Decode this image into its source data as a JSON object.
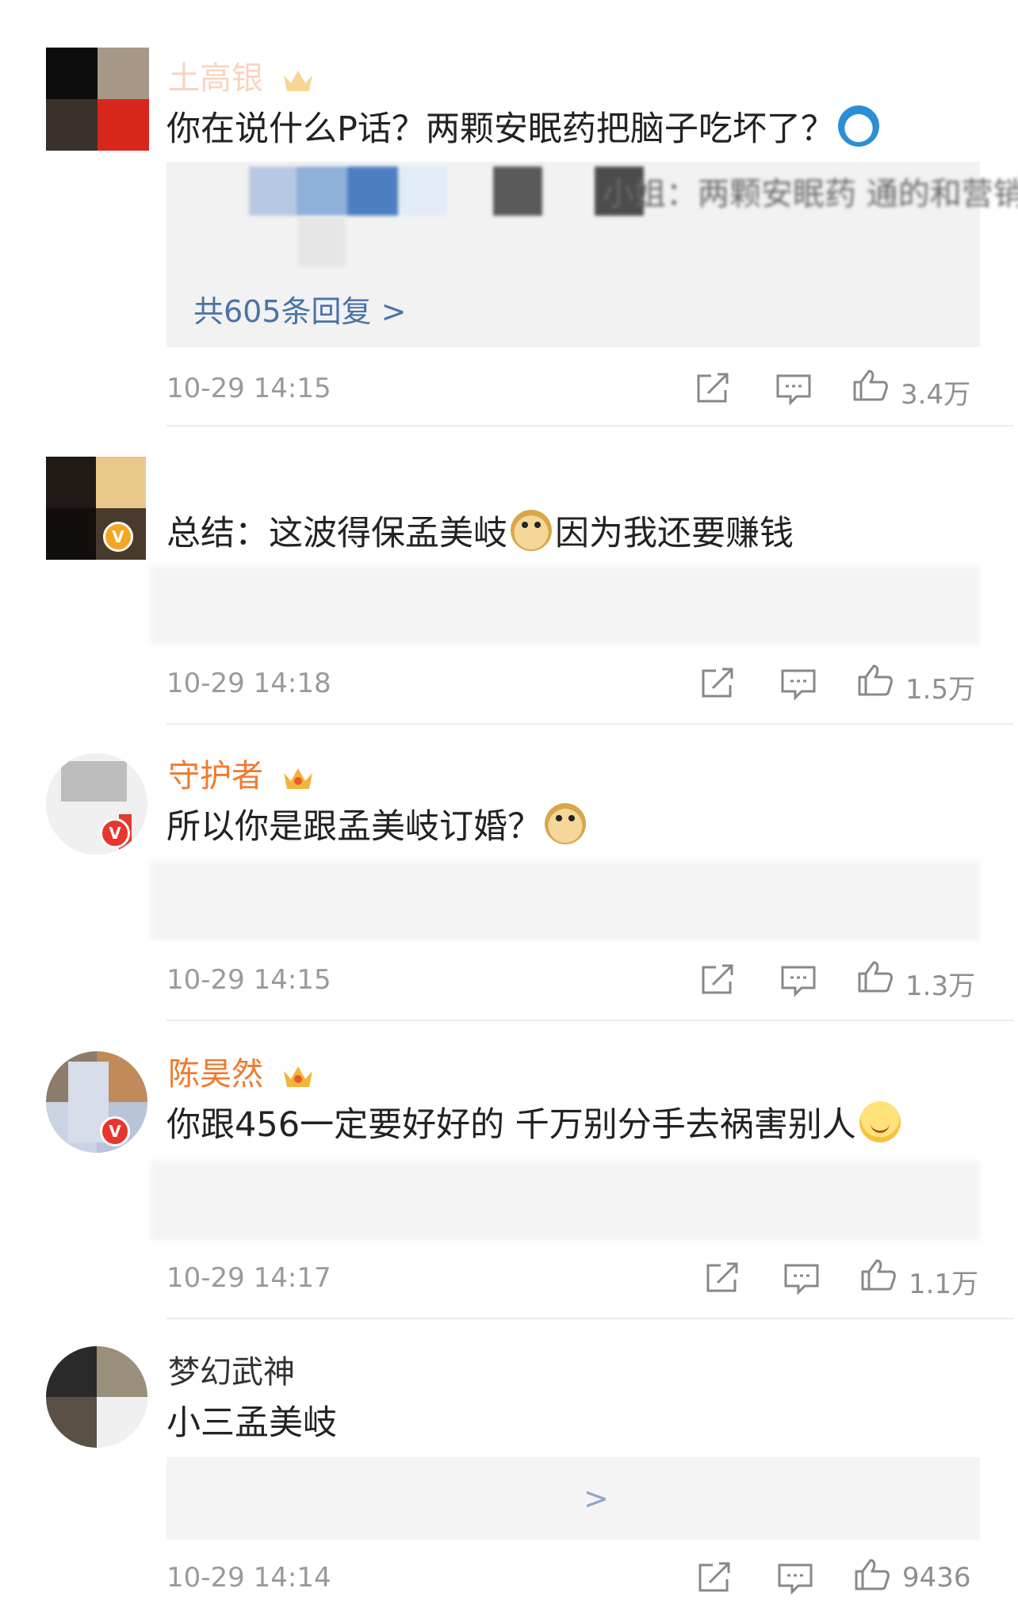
{
  "comments": [
    {
      "username": "土高银",
      "text": "你在说什么P话？两颗安眠药把脑子吃坏了？",
      "emoji_after": "doraemon-emoji",
      "reply_preview": "小姐：两颗安眠药 通的和营销",
      "reply_link": "共605条回复 >",
      "time": "10-29 14:15",
      "likes": "3.4万"
    },
    {
      "username": "",
      "text_before": "总结：这波得保孟美岐",
      "text_after": "因为我还要赚钱",
      "emoji_mid": "doge-emoji",
      "time": "10-29 14:18",
      "likes": "1.5万"
    },
    {
      "username": "守护者",
      "text": "所以你是跟孟美岐订婚？",
      "emoji_after": "doge-emoji",
      "time": "10-29 14:15",
      "likes": "1.3万"
    },
    {
      "username": "陈昊然",
      "text": "你跟456一定要好好的 千万别分手去祸害别人",
      "emoji_after": "smile-emoji",
      "time": "10-29 14:17",
      "likes": "1.1万"
    },
    {
      "username": "梦幻武神",
      "text": "小三孟美岐",
      "reply_link": ">",
      "time": "10-29 14:14",
      "likes": "9436"
    }
  ],
  "colors": {
    "username_orange": "#f07a2d",
    "reply_link_blue": "#4a73a8",
    "meta_gray": "#9a9a9a",
    "reply_bg": "#f2f2f2"
  },
  "icons": [
    "share-icon",
    "comment-icon",
    "like-icon",
    "crown-icon",
    "verified-badge"
  ]
}
